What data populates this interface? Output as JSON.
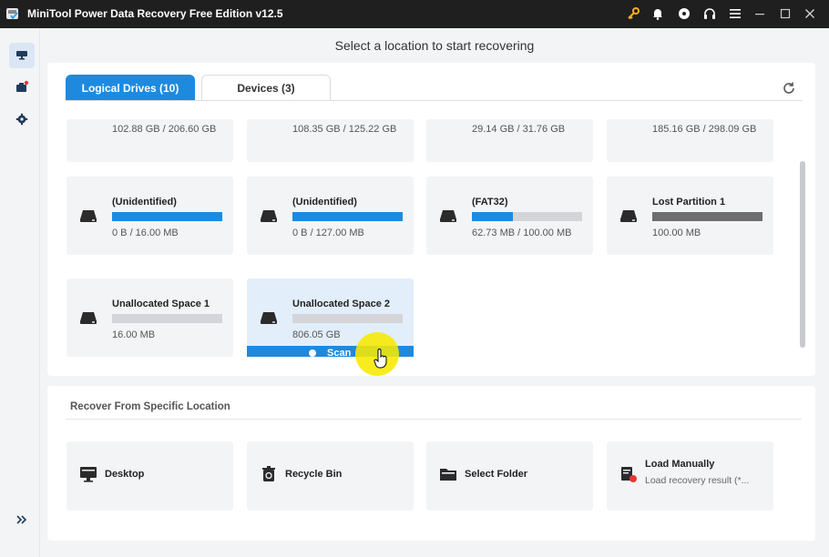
{
  "window": {
    "title": "MiniTool Power Data Recovery Free Edition v12.5"
  },
  "header": {
    "title": "Select a location to start recovering"
  },
  "tabs": [
    {
      "label": "Logical Drives (10)",
      "active": true
    },
    {
      "label": "Devices (3)",
      "active": false
    }
  ],
  "drives_partial": [
    {
      "size": "102.88 GB / 206.60 GB"
    },
    {
      "size": "108.35 GB / 125.22 GB"
    },
    {
      "size": "29.14 GB / 31.76 GB"
    },
    {
      "size": "185.16 GB / 298.09 GB"
    }
  ],
  "drives": [
    {
      "name": "(Unidentified)",
      "size": "0 B / 16.00 MB",
      "fill_fraction": 1.0,
      "fill_color": "#1d8ae0"
    },
    {
      "name": "(Unidentified)",
      "size": "0 B / 127.00 MB",
      "fill_fraction": 1.0,
      "fill_color": "#1d8ae0"
    },
    {
      "name": "(FAT32)",
      "size": "62.73 MB / 100.00 MB",
      "fill_fraction": 0.37,
      "fill_color": "#1d8ae0"
    },
    {
      "name": "Lost Partition 1",
      "size": "100.00 MB",
      "fill_fraction": 1.0,
      "fill_color": "#6e6e6e"
    },
    {
      "name": "Unallocated Space 1",
      "size": "16.00 MB",
      "fill_fraction": 0.0
    },
    {
      "name": "Unallocated Space 2",
      "size": "806.05 GB",
      "fill_fraction": 0.0,
      "selected": true,
      "scan_label": "Scan"
    }
  ],
  "specific": {
    "title": "Recover From Specific Location",
    "items": [
      {
        "label": "Desktop",
        "icon": "desktop-icon"
      },
      {
        "label": "Recycle Bin",
        "icon": "recycle-bin-icon"
      },
      {
        "label": "Select Folder",
        "icon": "folder-icon"
      },
      {
        "label": "Load Manually",
        "sublabel": "Load recovery result (*...",
        "icon": "load-icon"
      }
    ]
  },
  "colors": {
    "accent": "#1d8ae0",
    "titlebar": "#1f1f1f",
    "badge": "#e53935",
    "highlight": "#f7e900"
  }
}
